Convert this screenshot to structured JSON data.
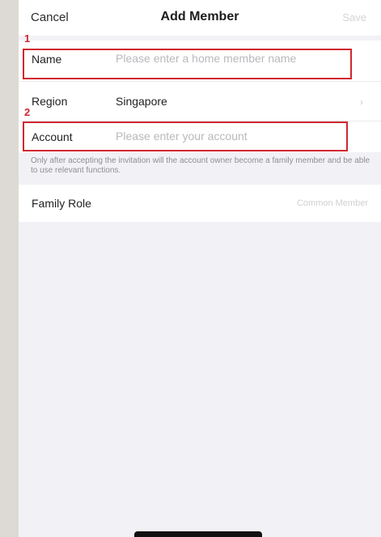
{
  "navbar": {
    "cancel_label": "Cancel",
    "title": "Add Member",
    "save_label": "Save"
  },
  "form": {
    "name": {
      "label": "Name",
      "placeholder": "Please enter a home member name"
    },
    "region": {
      "label": "Region",
      "value": "Singapore",
      "chevron_icon": "chevron-right-icon"
    },
    "account": {
      "label": "Account",
      "placeholder": "Please enter your account"
    },
    "hint": "Only after accepting the invitation will the account owner become a family member and be able to use relevant functions.",
    "family_role": {
      "label": "Family Role",
      "value": "Common Member"
    }
  },
  "annotations": [
    {
      "number": "1",
      "color": "#d0272f"
    },
    {
      "number": "2",
      "color": "#d0272f"
    }
  ]
}
